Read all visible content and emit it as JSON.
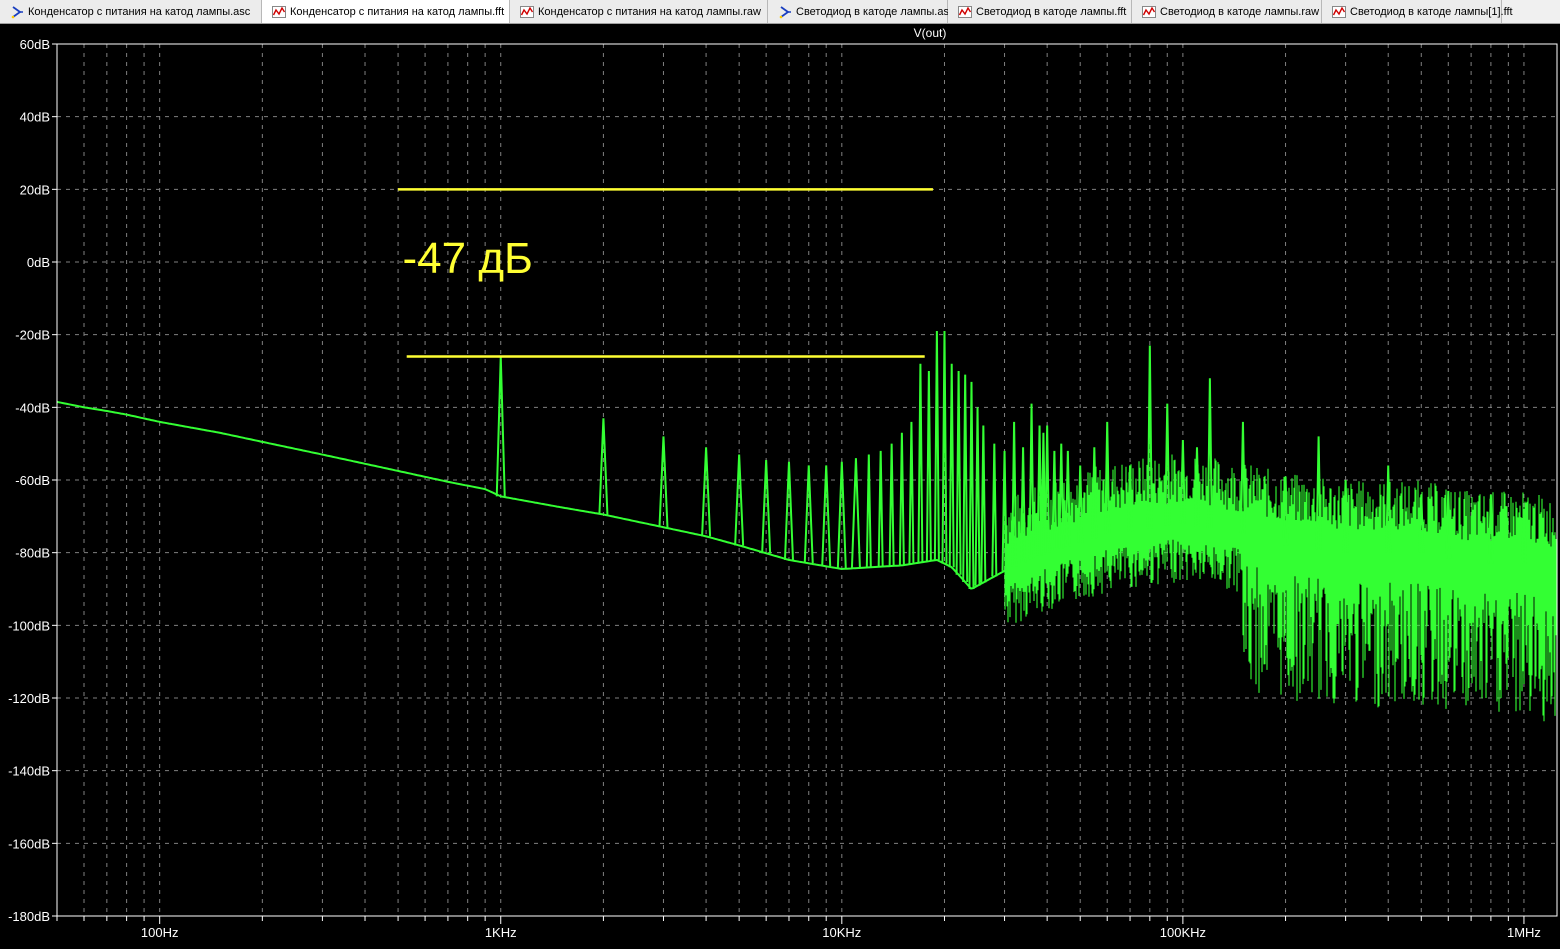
{
  "tabs": [
    {
      "label": "Конденсатор с питания на катод лампы.asc",
      "icon": "schematic-icon",
      "active": false
    },
    {
      "label": "Конденсатор с питания на катод лампы.fft",
      "icon": "waveform-icon",
      "active": true
    },
    {
      "label": "Конденсатор с питания на катод лампы.raw",
      "icon": "waveform-icon",
      "active": false
    },
    {
      "label": "Светодиод в катоде лампы.asc",
      "icon": "schematic-icon",
      "active": false
    },
    {
      "label": "Светодиод в катоде лампы.fft",
      "icon": "waveform-icon",
      "active": false
    },
    {
      "label": "Светодиод в катоде лампы.raw",
      "icon": "waveform-icon",
      "active": false
    },
    {
      "label": "Светодиод в катоде лампы[1].fft",
      "icon": "waveform-icon",
      "active": false
    }
  ],
  "colors": {
    "background": "#000000",
    "grid": "#808080",
    "trace": "#33ff33",
    "annotation": "#ffff33",
    "axis_text": "#ffffff"
  },
  "chart_data": {
    "type": "line",
    "title": "V(out)",
    "xscale": "log",
    "xlim": [
      50,
      1250000
    ],
    "ylim": [
      -180,
      60
    ],
    "y_ticks": [
      60,
      40,
      20,
      0,
      -20,
      -40,
      -60,
      -80,
      -100,
      -120,
      -140,
      -160,
      -180
    ],
    "y_tick_labels": [
      "60dB",
      "40dB",
      "20dB",
      "0dB",
      "-20dB",
      "-40dB",
      "-60dB",
      "-80dB",
      "-100dB",
      "-120dB",
      "-140dB",
      "-160dB",
      "-180dB"
    ],
    "x_major": [
      100,
      1000,
      10000,
      100000,
      1000000
    ],
    "x_tick_labels": [
      "100Hz",
      "1KHz",
      "10KHz",
      "100KHz",
      "1MHz"
    ],
    "grid": true,
    "series": [
      {
        "noise_floor": {
          "x": [
            50,
            60,
            70,
            80,
            100,
            150,
            200,
            300,
            500,
            700,
            900,
            1000,
            1500,
            2000,
            3000,
            4000,
            5000,
            7000,
            10000,
            15000,
            19000,
            21000,
            24000,
            30000,
            40000,
            60000,
            100000,
            150000,
            200000,
            300000,
            500000,
            700000,
            1000000,
            1250000
          ],
          "y": [
            -38.5,
            -40,
            -41,
            -42,
            -44,
            -47,
            -49.5,
            -53,
            -57.5,
            -60.5,
            -62.5,
            -64.5,
            -67.5,
            -69.5,
            -73,
            -75.5,
            -78,
            -82,
            -84.5,
            -83.5,
            -82,
            -84,
            -90,
            -85,
            -80,
            -75,
            -72,
            -75,
            -78,
            -80,
            -80,
            -83,
            -83,
            -85
          ]
        },
        "peaks": {
          "x": [
            1000,
            2000,
            3000,
            4000,
            5000,
            6000,
            7000,
            8000,
            9000,
            10000,
            11000,
            12000,
            13000,
            14000,
            15000,
            16000,
            17000,
            18000,
            19000,
            20000,
            21000,
            22000,
            23000,
            24000,
            25000,
            26000,
            28000,
            30000,
            32000,
            34000,
            36000,
            38000,
            39000,
            40000,
            42000,
            44000,
            46000,
            50000,
            55000,
            60000,
            70000,
            80000,
            90000,
            100000,
            110000,
            120000,
            150000,
            200000,
            250000,
            300000,
            400000,
            500000,
            600000,
            800000,
            1000000
          ],
          "y": [
            -26,
            -43,
            -48,
            -51,
            -53,
            -54.5,
            -55,
            -56,
            -56,
            -55,
            -54,
            -53,
            -52,
            -50,
            -47,
            -44,
            -28,
            -30,
            -19,
            -19,
            -28,
            -30,
            -31,
            -33,
            -40,
            -45,
            -50,
            -52,
            -44,
            -51,
            -39,
            -45,
            -47,
            -45,
            -52,
            -50,
            -52,
            -56,
            -51,
            -44,
            -56,
            -23,
            -39,
            -49,
            -51,
            -32,
            -44,
            -59,
            -48,
            -60,
            -56,
            -64,
            -63,
            -64,
            -68
          ]
        }
      }
    ],
    "annotations": [
      {
        "type": "hline",
        "y": 20,
        "x_from": 500,
        "x_to": 18500
      },
      {
        "type": "hline",
        "y": -26,
        "x_from": 530,
        "x_to": 17500
      },
      {
        "type": "text",
        "text": "-47 дБ",
        "x": 800,
        "y": -3
      }
    ]
  }
}
